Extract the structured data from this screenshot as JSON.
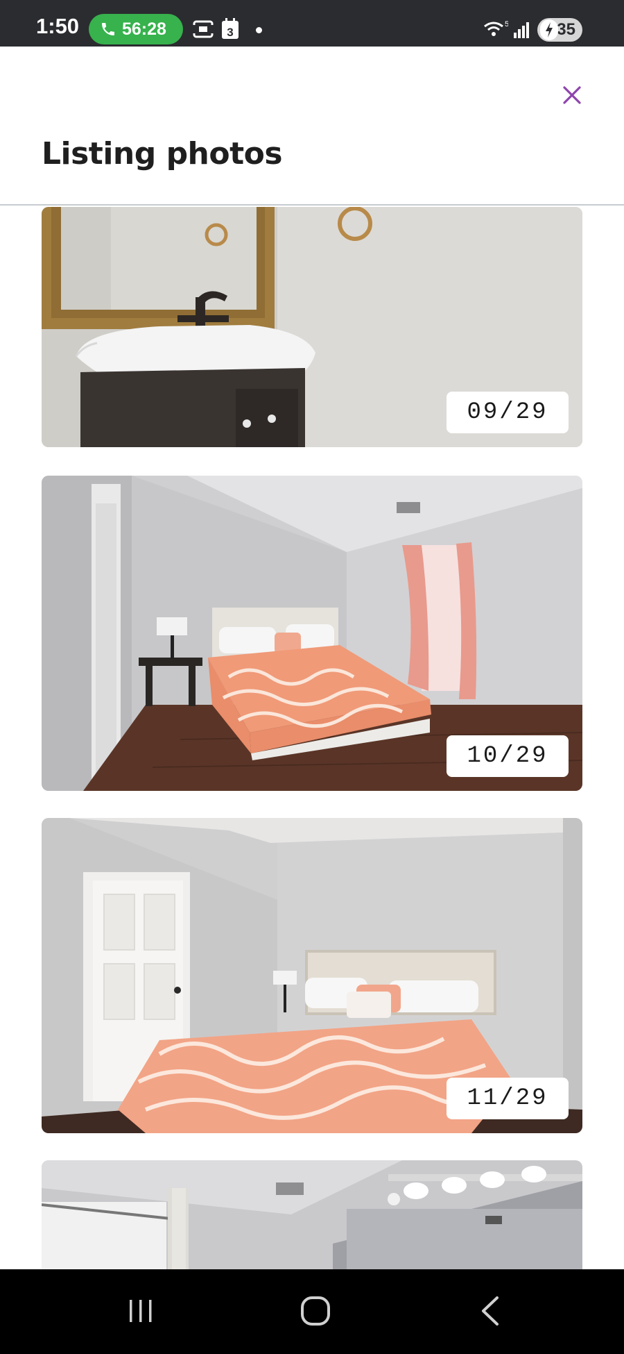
{
  "status_bar": {
    "time": "1:50",
    "call_duration": "56:28",
    "battery_level": "35",
    "wifi_label": "5",
    "calendar_badge": "3"
  },
  "header": {
    "title": "Listing photos",
    "close_icon": "close-icon",
    "accent_color": "#8e44ad"
  },
  "photos": [
    {
      "counter": "09/29",
      "subject": "bathroom-vanity"
    },
    {
      "counter": "10/29",
      "subject": "bedroom-window"
    },
    {
      "counter": "11/29",
      "subject": "bedroom-closet"
    },
    {
      "counter": "",
      "subject": "bathroom-shower"
    }
  ],
  "nav_bar": {
    "recent_icon": "recent-apps-icon",
    "home_icon": "home-icon",
    "back_icon": "back-icon"
  }
}
